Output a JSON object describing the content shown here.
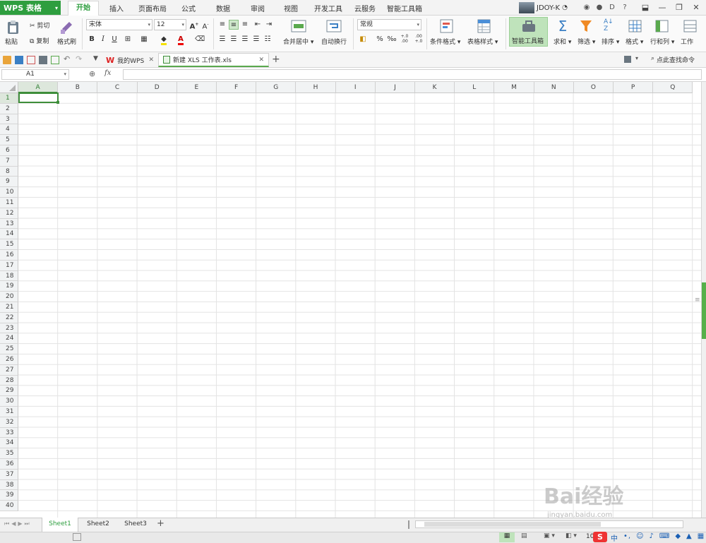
{
  "app": {
    "name": "WPS 表格"
  },
  "menu": {
    "tabs": [
      "开始",
      "插入",
      "页面布局",
      "公式",
      "数据",
      "审阅",
      "视图",
      "开发工具",
      "云服务",
      "智能工具箱"
    ],
    "active": "开始"
  },
  "user": {
    "name": "JDOY-K"
  },
  "ribbon": {
    "paste": "粘贴",
    "cut": "剪切",
    "copy": "复制",
    "format_painter": "格式刷",
    "font_name": "宋体",
    "font_size": "12",
    "bold": "B",
    "italic": "I",
    "underline": "U",
    "merge_center": "合并居中",
    "wrap_text": "自动换行",
    "number_format": "常规",
    "percent": "%",
    "comma": "‰",
    "inc_decimal": "+.0 .00",
    "dec_decimal": ".00 +.0",
    "cond_format": "条件格式",
    "table_style": "表格样式",
    "smart_toolbox": "智能工具箱",
    "sum": "求和",
    "filter": "筛选",
    "sort": "排序",
    "format": "格式",
    "rows_cols": "行和列",
    "worksheet": "工作"
  },
  "doctabs": [
    {
      "label": "我的WPS"
    },
    {
      "label": "新建 XLS 工作表.xls"
    }
  ],
  "search": {
    "label": "点此查找命令"
  },
  "formula_bar": {
    "name_box": "A1",
    "fx": "fx",
    "content": ""
  },
  "columns": [
    "A",
    "B",
    "C",
    "D",
    "E",
    "F",
    "G",
    "H",
    "I",
    "J",
    "K",
    "L",
    "M",
    "N",
    "O",
    "P",
    "Q"
  ],
  "rows": [
    "1",
    "2",
    "3",
    "4",
    "5",
    "6",
    "7",
    "8",
    "9",
    "10",
    "11",
    "12",
    "13",
    "14",
    "15",
    "16",
    "17",
    "18",
    "19",
    "20",
    "21",
    "22",
    "23",
    "24",
    "25",
    "26",
    "27",
    "28",
    "29",
    "30",
    "31",
    "32",
    "33",
    "34",
    "35",
    "36",
    "37",
    "38",
    "39",
    "40"
  ],
  "sheets": [
    {
      "label": "Sheet1"
    },
    {
      "label": "Sheet2"
    },
    {
      "label": "Sheet3"
    }
  ],
  "active_sheet": "Sheet1",
  "status": {
    "zoom": "10"
  },
  "watermark": {
    "text": "Bai经验",
    "sub": "jingyan.baidu.com"
  },
  "colors": {
    "accent": "#2e9e3f",
    "grid_line": "#e3e3e3",
    "header_bg": "#f1f3f4"
  }
}
